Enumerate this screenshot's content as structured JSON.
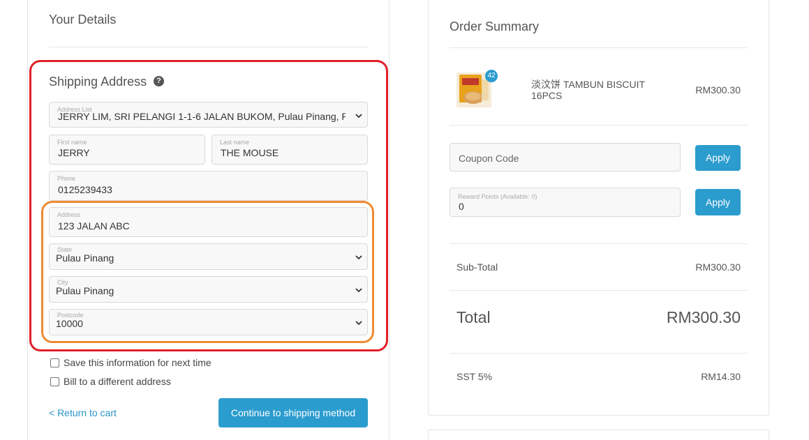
{
  "details": {
    "title": "Your Details"
  },
  "shipping": {
    "title": "Shipping Address",
    "help_icon": "?",
    "address_list": {
      "label": "Address List",
      "value": "JERRY LIM, SRI PELANGI 1-1-6 JALAN BUKOM, Pulau Pinang, P"
    },
    "first_name": {
      "label": "First name",
      "value": "JERRY"
    },
    "last_name": {
      "label": "Last name",
      "value": "THE MOUSE"
    },
    "phone": {
      "label": "Phone",
      "value": "0125239433"
    },
    "address": {
      "label": "Address",
      "value": "123 JALAN ABC"
    },
    "state": {
      "label": "State",
      "value": "Pulau Pinang"
    },
    "city": {
      "label": "City",
      "value": "Pulau Pinang"
    },
    "postcode": {
      "label": "Postcode",
      "value": "10000"
    }
  },
  "options": {
    "save_info": "Save this information for next time",
    "bill_different": "Bill to a different address"
  },
  "footer": {
    "return_link": "< Return to cart",
    "continue_button": "Continue to shipping method"
  },
  "summary": {
    "title": "Order Summary",
    "item": {
      "name": "淡汶饼 TAMBUN BISCUIT 16PCS",
      "price": "RM300.30",
      "quantity_badge": "42"
    },
    "coupon": {
      "placeholder": "Coupon Code",
      "apply": "Apply"
    },
    "reward": {
      "label": "Reward Points (Available: 0)",
      "value": "0",
      "apply": "Apply"
    },
    "subtotal": {
      "label": "Sub-Total",
      "value": "RM300.30"
    },
    "total": {
      "label": "Total",
      "value": "RM300.30"
    },
    "sst": {
      "label": "SST 5%",
      "value": "RM14.30"
    }
  },
  "colors": {
    "accent": "#2b9cce",
    "highlight_outer": "#e0202a",
    "highlight_inner": "#f08a32"
  }
}
